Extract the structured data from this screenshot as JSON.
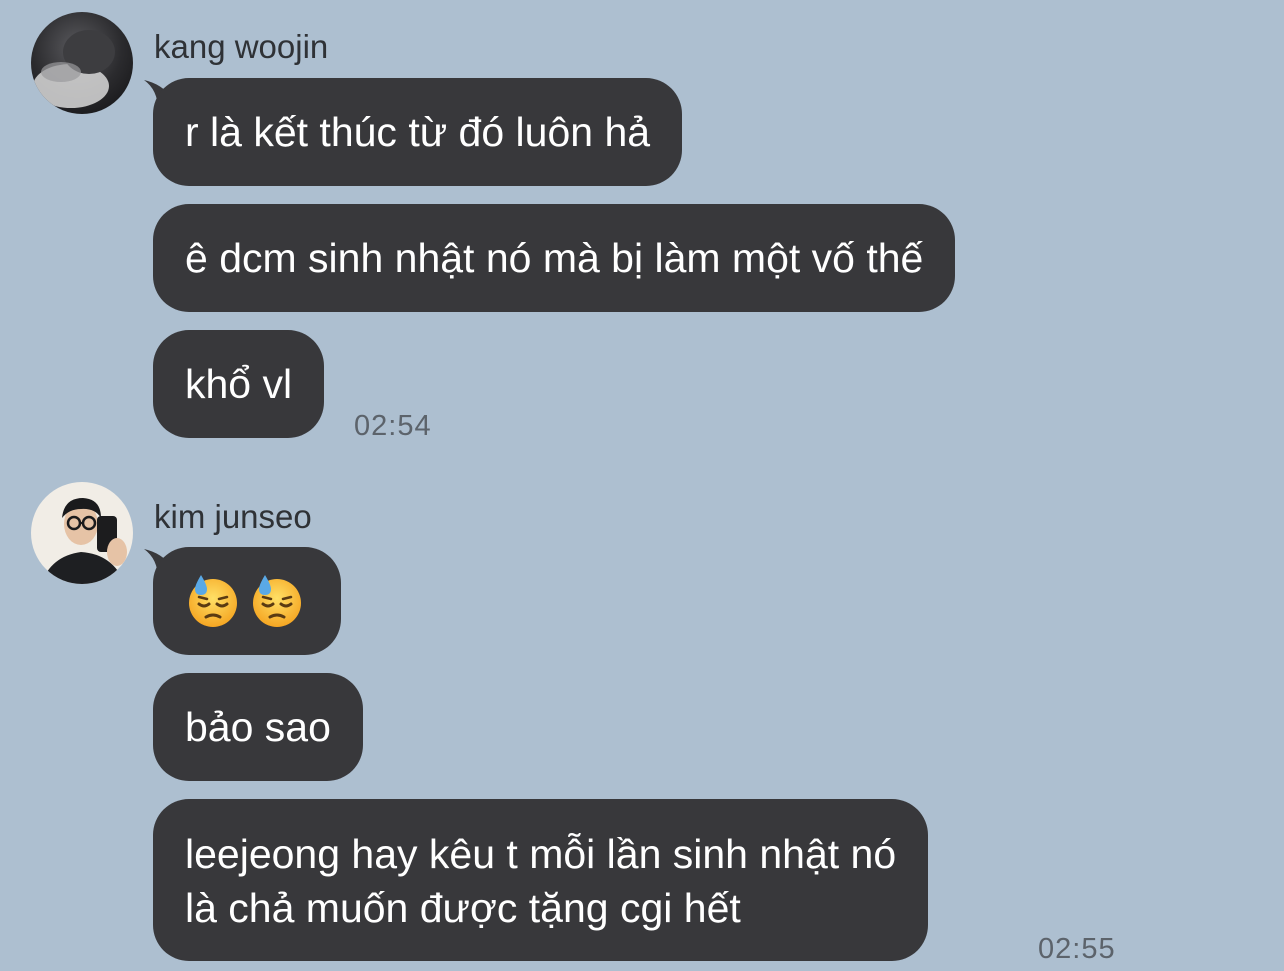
{
  "groups": [
    {
      "sender": "kang woojin",
      "messages": [
        "r là kết thúc từ đó luôn hả",
        "ê dcm sinh nhật nó mà bị làm một vố thế",
        "khổ vl"
      ],
      "time": "02:54"
    },
    {
      "sender": "kim junseo",
      "messages": [
        "😓😓",
        "bảo sao",
        "leejeong hay kêu t mỗi lần sinh nhật nó",
        "là chả muốn được tặng cgi hết"
      ],
      "time": "02:55"
    }
  ],
  "colors": {
    "background": "#adbfd0",
    "bubble": "#38383b",
    "bubble_text": "#ffffff",
    "sender_text": "#2f3236",
    "time_text": "#5c636b"
  },
  "icons": {
    "emoji": "downcast-face-with-sweat-emoji"
  }
}
